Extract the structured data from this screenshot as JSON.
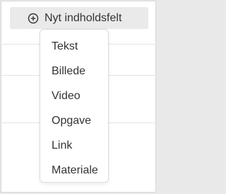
{
  "toolbar": {
    "add_button_label": "Nyt indholdsfelt",
    "add_button_icon": "plus-circle-icon"
  },
  "menu": {
    "items": [
      {
        "label": "Tekst"
      },
      {
        "label": "Billede"
      },
      {
        "label": "Video"
      },
      {
        "label": "Opgave"
      },
      {
        "label": "Link"
      },
      {
        "label": "Materiale"
      }
    ]
  },
  "colors": {
    "button_bg": "#eaeaea",
    "text": "#333333",
    "menu_border": "#dcdcdc",
    "divider": "#e4e4e4"
  }
}
